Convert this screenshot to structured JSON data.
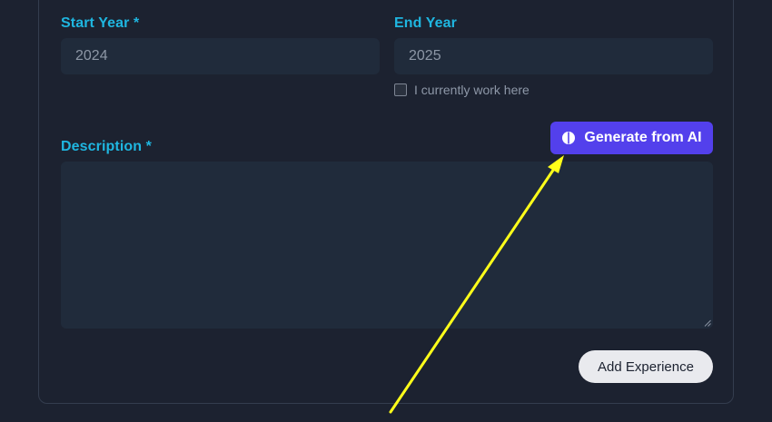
{
  "form": {
    "start_year_label": "Start Year *",
    "start_year_value": "2024",
    "end_year_label": "End Year",
    "end_year_value": "2025",
    "current_work_label": "I currently work here",
    "current_work_checked": false,
    "description_label": "Description *",
    "description_value": "",
    "generate_ai_label": "Generate from AI",
    "add_experience_label": "Add Experience"
  },
  "annotation": {
    "arrow_color": "#ffff1a",
    "arrow_target": "generate-ai-button"
  },
  "colors": {
    "accent_label": "#1fb6e0",
    "ai_button": "#5340ec",
    "background": "#1c2230",
    "field": "#202b3b"
  }
}
